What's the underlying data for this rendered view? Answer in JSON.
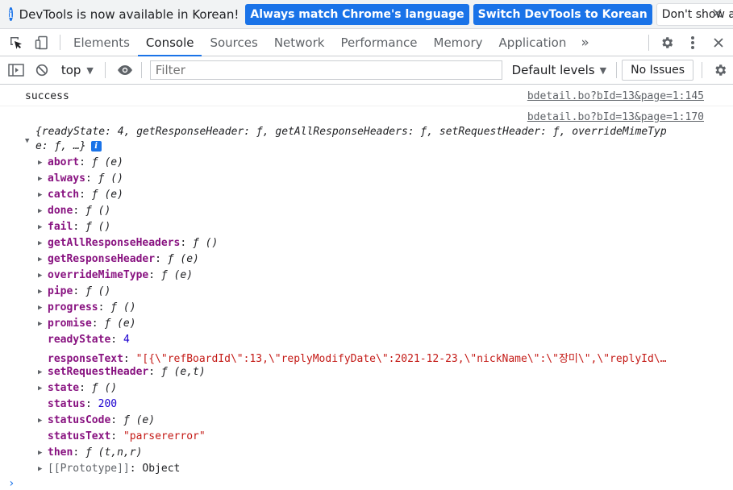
{
  "infobar": {
    "message": "DevTools is now available in Korean!",
    "btn_match": "Always match Chrome's language",
    "btn_switch": "Switch DevTools to Korean",
    "btn_dont": "Don't show again",
    "close": "×"
  },
  "tabs": [
    {
      "label": "Elements"
    },
    {
      "label": "Console"
    },
    {
      "label": "Sources"
    },
    {
      "label": "Network"
    },
    {
      "label": "Performance"
    },
    {
      "label": "Memory"
    },
    {
      "label": "Application"
    }
  ],
  "tabs_more": "»",
  "toolbar": {
    "context": "top",
    "filter_placeholder": "Filter",
    "levels": "Default levels",
    "issues": "No Issues"
  },
  "console": {
    "msg1": {
      "text": "success",
      "source": "bdetail.bo?bId=13&page=1:145"
    },
    "msg2": {
      "source": "bdetail.bo?bId=13&page=1:170",
      "summary_line1": "{readyState: 4, getResponseHeader: ƒ, getAllResponseHeaders: ƒ, setRequestHeader: ƒ, overrideMimeTyp",
      "summary_line2": "e: ƒ, …}",
      "badge": "i",
      "props": [
        {
          "key": "abort",
          "value": "ƒ (e)",
          "expandable": true,
          "kind": "fn"
        },
        {
          "key": "always",
          "value": "ƒ ()",
          "expandable": true,
          "kind": "fn"
        },
        {
          "key": "catch",
          "value": "ƒ (e)",
          "expandable": true,
          "kind": "fn"
        },
        {
          "key": "done",
          "value": "ƒ ()",
          "expandable": true,
          "kind": "fn"
        },
        {
          "key": "fail",
          "value": "ƒ ()",
          "expandable": true,
          "kind": "fn"
        },
        {
          "key": "getAllResponseHeaders",
          "value": "ƒ ()",
          "expandable": true,
          "kind": "fn"
        },
        {
          "key": "getResponseHeader",
          "value": "ƒ (e)",
          "expandable": true,
          "kind": "fn"
        },
        {
          "key": "overrideMimeType",
          "value": "ƒ (e)",
          "expandable": true,
          "kind": "fn"
        },
        {
          "key": "pipe",
          "value": "ƒ ()",
          "expandable": true,
          "kind": "fn"
        },
        {
          "key": "progress",
          "value": "ƒ ()",
          "expandable": true,
          "kind": "fn"
        },
        {
          "key": "promise",
          "value": "ƒ (e)",
          "expandable": true,
          "kind": "fn"
        },
        {
          "key": "readyState",
          "value": "4",
          "expandable": false,
          "kind": "num"
        },
        {
          "key": "responseText",
          "value": "\"[{\\\"refBoardId\\\":13,\\\"replyModifyDate\\\":2021-12-23,\\\"nickName\\\":\\\"장미\\\",\\\"replyId\\…",
          "expandable": false,
          "kind": "str"
        },
        {
          "key": "setRequestHeader",
          "value": "ƒ (e,t)",
          "expandable": true,
          "kind": "fn"
        },
        {
          "key": "state",
          "value": "ƒ ()",
          "expandable": true,
          "kind": "fn"
        },
        {
          "key": "status",
          "value": "200",
          "expandable": false,
          "kind": "num"
        },
        {
          "key": "statusCode",
          "value": "ƒ (e)",
          "expandable": true,
          "kind": "fn"
        },
        {
          "key": "statusText",
          "value": "\"parsererror\"",
          "expandable": false,
          "kind": "str"
        },
        {
          "key": "then",
          "value": "ƒ (t,n,r)",
          "expandable": true,
          "kind": "fn"
        },
        {
          "key": "[[Prototype]]",
          "value": "Object",
          "expandable": true,
          "kind": "proto"
        }
      ]
    },
    "prompt": "›"
  }
}
